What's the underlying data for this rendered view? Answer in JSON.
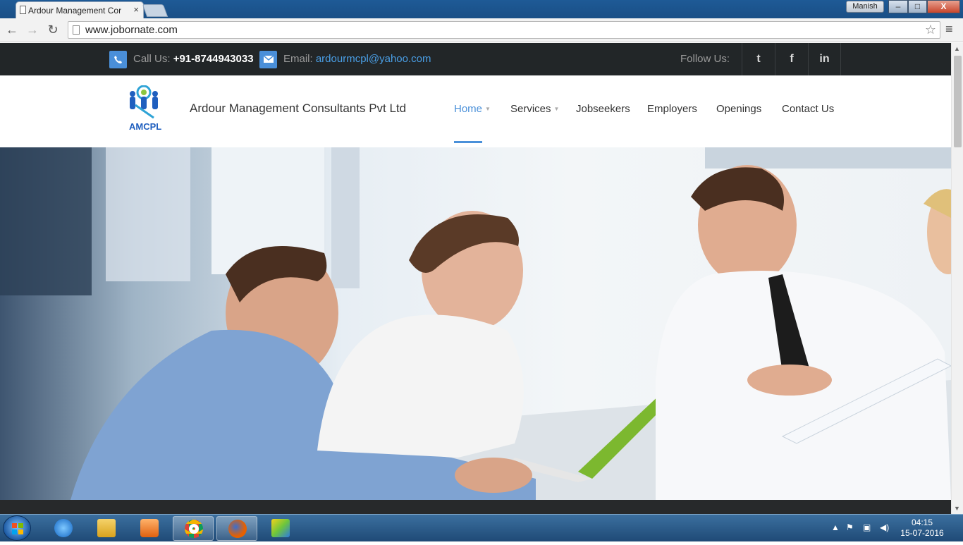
{
  "browser": {
    "tab_title": "Ardour Management Cor",
    "close_glyph": "×",
    "user_name": "Manish",
    "min_glyph": "–",
    "max_glyph": "□",
    "close_window_glyph": "X",
    "back_glyph": "←",
    "forward_glyph": "→",
    "reload_glyph": "↻",
    "url": "www.jobornate.com",
    "star_glyph": "☆",
    "menu_glyph": "≡"
  },
  "topbar": {
    "call_prefix": "Call Us: ",
    "phone": "+91-8744943033",
    "email_prefix": "Email: ",
    "email": "ardourmcpl@yahoo.com",
    "follow_label": "Follow Us:",
    "social": {
      "twitter": "t",
      "facebook": "f",
      "linkedin": "in"
    }
  },
  "header": {
    "logo_text": "AMCPL",
    "company_name": "Ardour Management Consultants Pvt Ltd",
    "nav": {
      "home": "Home",
      "services": "Services",
      "jobseekers": "Jobseekers",
      "employers": "Employers",
      "openings": "Openings",
      "contact": "Contact Us"
    }
  },
  "taskbar": {
    "time": "04:15",
    "date": "15-07-2016"
  },
  "colors": {
    "accent": "#4a90d9",
    "topbar_bg": "#222628"
  }
}
